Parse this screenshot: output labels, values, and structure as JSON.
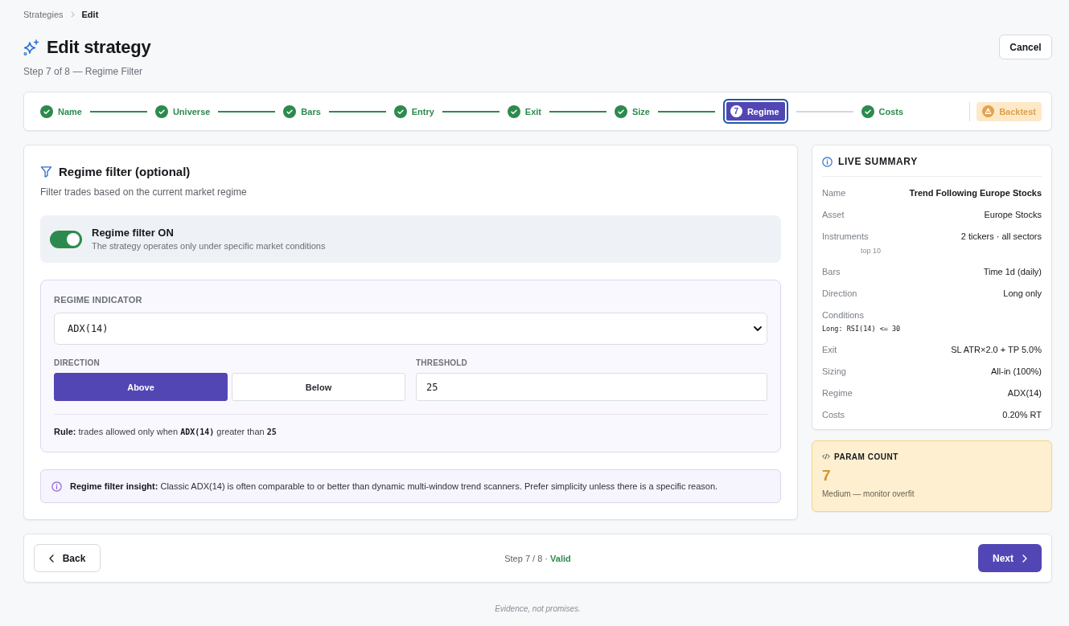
{
  "breadcrumb": [
    {
      "label": "Strategies",
      "current": false
    },
    {
      "label": "Edit",
      "current": true
    }
  ],
  "header": {
    "title": "Edit strategy",
    "subtitle": "Step 7 of 8 — Regime Filter",
    "cancel_button": "Cancel"
  },
  "stepper": [
    {
      "label": "Name",
      "kind": "done",
      "selected": false
    },
    {
      "label": "Universe",
      "kind": "done",
      "selected": false
    },
    {
      "label": "Bars",
      "kind": "done",
      "selected": false
    },
    {
      "label": "Entry",
      "kind": "done",
      "selected": false
    },
    {
      "label": "Exit",
      "kind": "done",
      "selected": false
    },
    {
      "label": "Size",
      "kind": "done",
      "selected": false
    },
    {
      "label": "Regime",
      "kind": "current",
      "number": "7",
      "selected": true
    },
    {
      "label": "Costs",
      "kind": "done",
      "selected": false
    },
    {
      "label": "Backtest",
      "kind": "warning",
      "selected": false
    }
  ],
  "regime_panel": {
    "title": "Regime filter (optional)",
    "description": "Filter trades based on the current market regime",
    "toggle": {
      "label": "Regime filter ON",
      "hint": "The strategy operates only under specific market conditions",
      "on": true
    },
    "indicator": {
      "label": "REGIME INDICATOR",
      "value": "ADX(14)"
    },
    "direction": {
      "label": "DIRECTION",
      "options": [
        {
          "label": "Above",
          "selected": true
        },
        {
          "label": "Below",
          "selected": false
        }
      ]
    },
    "threshold": {
      "label": "THRESHOLD",
      "value": "25"
    },
    "rule": {
      "label": "Rule:",
      "text_before": "trades allowed only when",
      "indicator": "ADX(14)",
      "text_middle": "greater than",
      "value": "25"
    },
    "insight": "**Regime filter insight:** Classic ADX(14) is often comparable to or better than dynamic multi-window trend scanners. Prefer simplicity unless there is a specific reason."
  },
  "summary": {
    "title": "LIVE SUMMARY",
    "rows": [
      {
        "kind": "strong",
        "label": "Name",
        "value": "Trend Following Europe Stocks"
      },
      {
        "kind": "pair",
        "label": "Asset",
        "value": "Europe Stocks"
      },
      {
        "kind": "pair",
        "label": "Instruments",
        "value": "2 tickers · all sectors",
        "note": "top 10"
      },
      {
        "kind": "pair",
        "label": "Bars",
        "value": "Time 1d (daily)"
      },
      {
        "kind": "pair",
        "label": "Direction",
        "value": "Long only"
      },
      {
        "kind": "code",
        "label": "Conditions",
        "value": "Long: RSI(14) <= 30"
      },
      {
        "kind": "pair",
        "label": "Exit",
        "value": "SL ATR×2.0 + TP 5.0%"
      },
      {
        "kind": "pair",
        "label": "Sizing",
        "value": "All-in (100%)"
      },
      {
        "kind": "pair",
        "label": "Regime",
        "value": "ADX(14)"
      },
      {
        "kind": "pair",
        "label": "Costs",
        "value": "0.20% RT"
      }
    ]
  },
  "param_count": {
    "title": "PARAM COUNT",
    "value": "7",
    "note": "Medium — monitor overfit"
  },
  "footer": {
    "back_button": "Back",
    "status": "Step 7 / 8 ·",
    "status_valid": "Valid",
    "next_button": "Next"
  },
  "tagline": "Evidence, not promises."
}
